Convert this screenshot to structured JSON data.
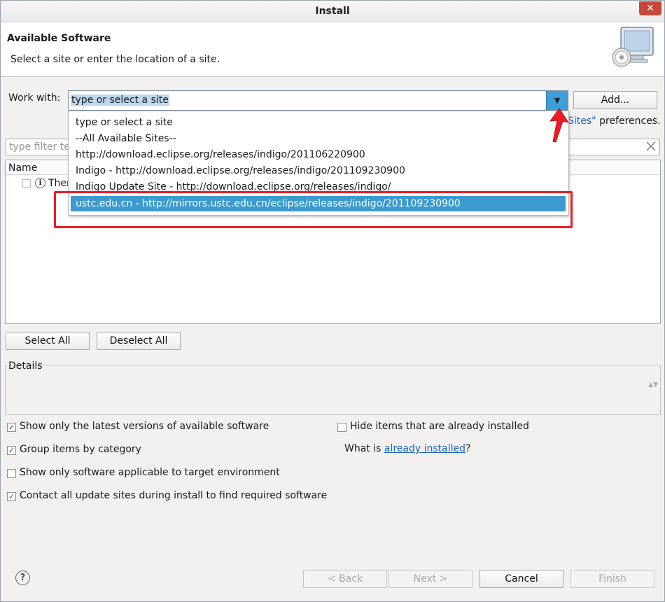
{
  "window": {
    "title": "Install",
    "close_symbol": "✕"
  },
  "header": {
    "title": "Available Software",
    "description": "Select a site or enter the location of a site."
  },
  "work_with": {
    "label": "Work with:",
    "value": "type or select a site",
    "add_button": "Add...",
    "dropdown_arrow": "▼"
  },
  "preferences": {
    "link_text": "Sites\"",
    "suffix": " preferences."
  },
  "dropdown_options": [
    "type or select a site",
    "--All Available Sites--",
    "http://download.eclipse.org/releases/indigo/201106220900",
    "Indigo - http://download.eclipse.org/releases/indigo/201109230900",
    "Indigo Update Site - http://download.eclipse.org/releases/indigo/",
    "ustc.edu.cn - http://mirrors.ustc.edu.cn/eclipse/releases/indigo/201109230900"
  ],
  "selected_option_index": 5,
  "filter": {
    "placeholder": "type filter te"
  },
  "tree": {
    "column_name": "Name",
    "row_text": "There",
    "info_symbol": "i"
  },
  "buttons": {
    "select_all": "Select All",
    "deselect_all": "Deselect All",
    "back": "< Back",
    "next": "Next >",
    "cancel": "Cancel",
    "finish": "Finish"
  },
  "details": {
    "label": "Details",
    "scroll_symbol": "▲▼"
  },
  "options": {
    "latest_versions": {
      "label": "Show only the latest versions of available software",
      "checked": true
    },
    "group_by_category": {
      "label": "Group items by category",
      "checked": true
    },
    "target_env": {
      "label": "Show only software applicable to target environment",
      "checked": false
    },
    "contact_sites": {
      "label": "Contact all update sites during install to find required software",
      "checked": true
    },
    "hide_installed": {
      "label": "Hide items that are already installed",
      "checked": false
    }
  },
  "what_is": {
    "prefix": "What is ",
    "link": "already installed",
    "suffix": "?"
  },
  "help_symbol": "?",
  "check_mark": "✓",
  "colors": {
    "selection": "#3c9ad0",
    "link": "#1967b8",
    "annotation_red": "#ef1c24"
  }
}
